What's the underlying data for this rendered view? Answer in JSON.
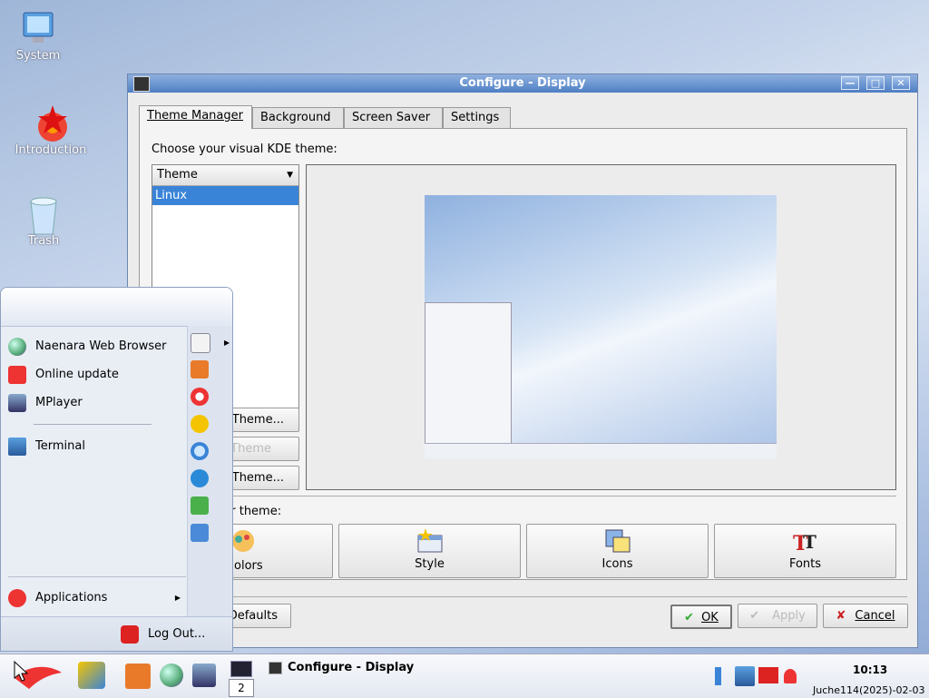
{
  "desktop": {
    "icons": [
      {
        "label": "System",
        "icon": "computer-icon"
      },
      {
        "label": "Introduction",
        "icon": "star-gear-icon"
      },
      {
        "label": "Trash",
        "icon": "trash-icon"
      }
    ]
  },
  "window": {
    "title": "Configure - Display",
    "tabs": [
      "Theme Manager",
      "Background",
      "Screen Saver",
      "Settings"
    ],
    "prompt": "Choose your visual KDE theme:",
    "theme_list": {
      "header": "Theme",
      "items": [
        "Linux"
      ]
    },
    "side_buttons": [
      "Theme...",
      "Theme",
      "Theme..."
    ],
    "customize_label": "ur theme:",
    "big_buttons": [
      "olors",
      "Style",
      "Icons",
      "Fonts"
    ],
    "bottom": {
      "defaults": "Defaults",
      "ok": "OK",
      "apply": "Apply",
      "cancel": "Cancel"
    }
  },
  "start_menu": {
    "items": [
      "Naenara Web Browser",
      "Online update",
      "MPlayer",
      "Terminal"
    ],
    "applications": "Applications",
    "logout": "Log Out..."
  },
  "taskbar": {
    "desktop_number": "2",
    "task_title": "Configure - Display",
    "time": "10:13",
    "date": "Juche114(2025)-02-03"
  },
  "colors": {
    "accent": "#4e7fc4",
    "selection": "#3a84d8"
  }
}
